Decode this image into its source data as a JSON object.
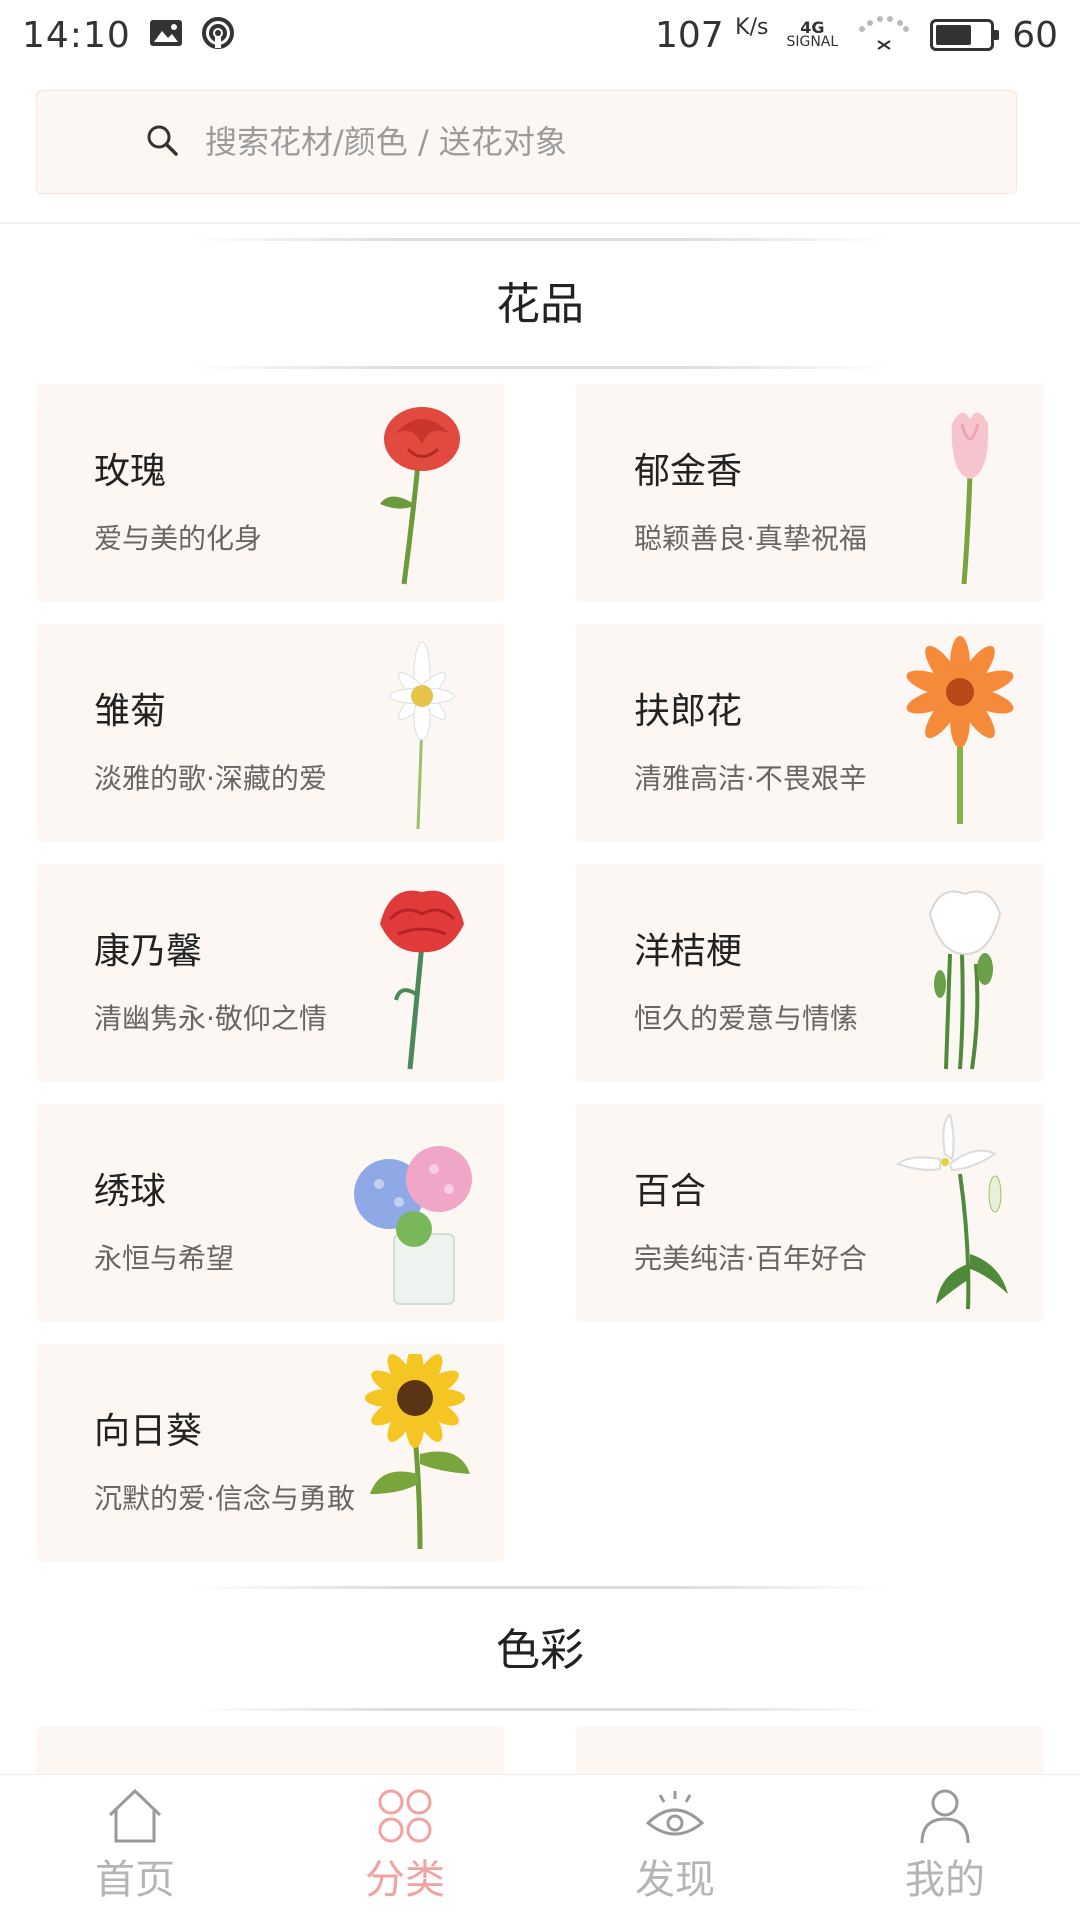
{
  "status_bar": {
    "time": "14:10",
    "net_speed": "107",
    "net_unit": "K/s",
    "signal_label": "4G",
    "signal_text": "SIGNAL",
    "battery": "60"
  },
  "search": {
    "placeholder": "搜索花材/颜色 / 送花对象"
  },
  "sections": {
    "flowers_title": "花品",
    "colors_title": "色彩"
  },
  "flowers": [
    {
      "name": "玫瑰",
      "desc": "爱与美的化身"
    },
    {
      "name": "郁金香",
      "desc": "聪颖善良·真挚祝福"
    },
    {
      "name": "雏菊",
      "desc": "淡雅的歌·深藏的爱"
    },
    {
      "name": "扶郎花",
      "desc": "清雅高洁·不畏艰辛"
    },
    {
      "name": "康乃馨",
      "desc": "清幽隽永·敬仰之情"
    },
    {
      "name": "洋桔梗",
      "desc": "恒久的爱意与情愫"
    },
    {
      "name": "绣球",
      "desc": "永恒与希望"
    },
    {
      "name": "百合",
      "desc": "完美纯洁·百年好合"
    },
    {
      "name": "向日葵",
      "desc": "沉默的爱·信念与勇敢"
    }
  ],
  "tabs": [
    {
      "label": "首页",
      "icon": "home-icon"
    },
    {
      "label": "分类",
      "icon": "category-icon",
      "active": true
    },
    {
      "label": "发现",
      "icon": "eye-icon"
    },
    {
      "label": "我的",
      "icon": "profile-icon"
    }
  ],
  "colors": {
    "bg_card": "#fcf7f3",
    "accent": "#f2a29f",
    "tab_inactive": "#b5b5b5"
  }
}
